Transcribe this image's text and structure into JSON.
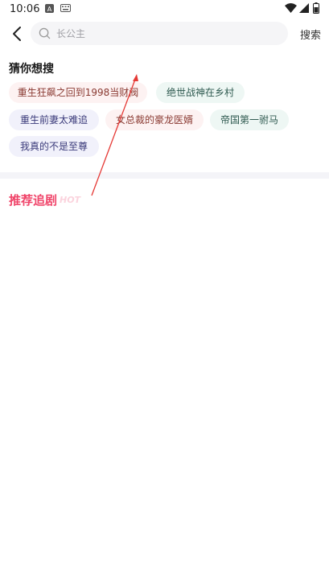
{
  "status_bar": {
    "time": "10:06",
    "icons": [
      "notification-a-icon",
      "keyboard-icon",
      "wifi-icon",
      "signal-icon",
      "battery-icon"
    ]
  },
  "header": {
    "back_icon": "chevron-left-icon",
    "search_placeholder": "长公主",
    "search_button": "搜索"
  },
  "guess": {
    "title": "猜你想搜",
    "chips": [
      {
        "label": "重生狂飙之回到1998当财阀",
        "style": "pink"
      },
      {
        "label": "绝世战神在乡村",
        "style": "mint"
      },
      {
        "label": "重生前妻太难追",
        "style": "lav"
      },
      {
        "label": "女总裁的豪龙医婿",
        "style": "pink"
      },
      {
        "label": "帝国第一驸马",
        "style": "mint"
      },
      {
        "label": "我真的不是至尊",
        "style": "lav"
      }
    ]
  },
  "recommend": {
    "title": "推荐追剧",
    "badge": "HOT"
  },
  "colors": {
    "accent": "#f0456a",
    "annotation_arrow": "#e53935"
  }
}
